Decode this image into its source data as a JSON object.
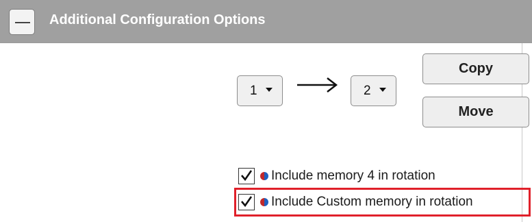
{
  "panel": {
    "title": "Additional Configuration Options",
    "collapse_icon": "minus-icon"
  },
  "transfer": {
    "source_value": "1",
    "target_value": "2",
    "arrow_icon": "right-arrow-icon",
    "copy_label": "Copy",
    "move_label": "Move"
  },
  "options": [
    {
      "checked": true,
      "label": "Include memory 4 in rotation",
      "icon": "memory-split-icon"
    },
    {
      "checked": true,
      "label": "Include Custom memory in rotation",
      "icon": "memory-split-icon",
      "highlighted": true
    }
  ],
  "colors": {
    "header_bg": "#a0a0a0",
    "highlight": "#e0202a",
    "icon_red": "#c0282a",
    "icon_blue": "#1f5fbf"
  }
}
